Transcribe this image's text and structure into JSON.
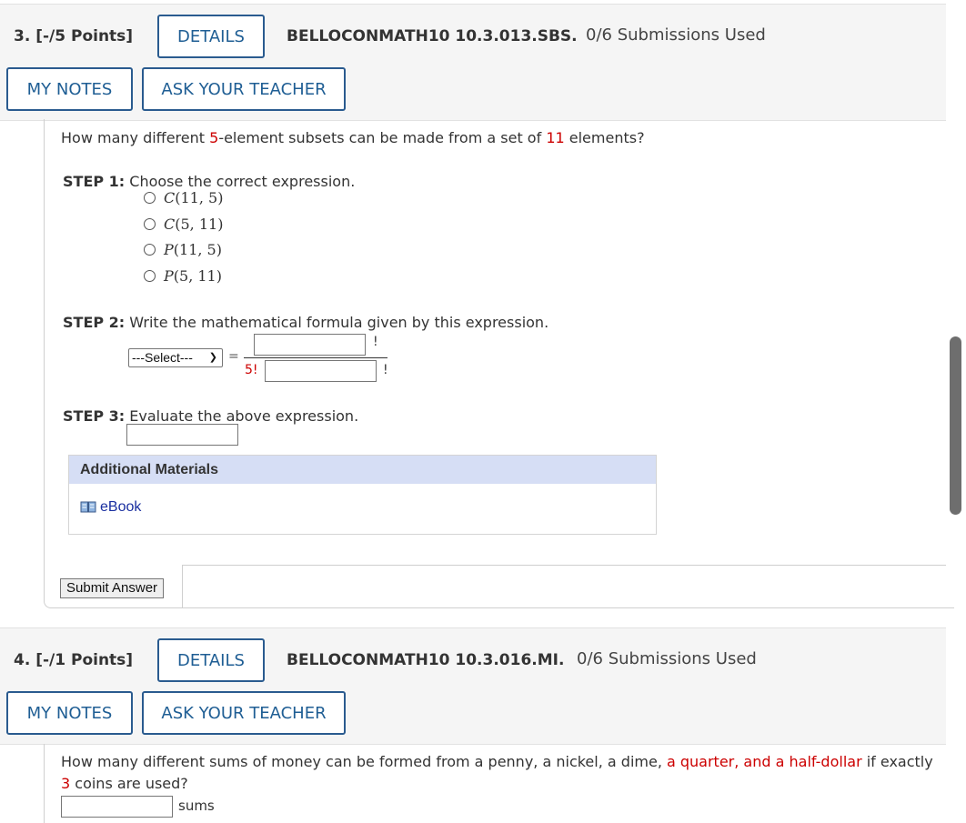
{
  "q3": {
    "number": "3.  [-/5 Points]",
    "details_label": "DETAILS",
    "code": "BELLOCONMATH10 10.3.013.SBS.",
    "submissions": "0/6 Submissions Used",
    "my_notes_label": "MY NOTES",
    "ask_teacher_label": "ASK YOUR TEACHER",
    "question": {
      "pre": "How many different ",
      "n1": "5",
      "mid": "-element subsets can be made from a set of ",
      "n2": "11",
      "post": " elements?"
    },
    "step1": {
      "label": "STEP 1:",
      "text": " Choose the correct expression.",
      "options": [
        {
          "fn": "C",
          "args": "(11, 5)"
        },
        {
          "fn": "C",
          "args": "(5, 11)"
        },
        {
          "fn": "P",
          "args": "(11, 5)"
        },
        {
          "fn": "P",
          "args": "(5, 11)"
        }
      ]
    },
    "step2": {
      "label": "STEP 2:",
      "text": " Write the mathematical formula given by this expression.",
      "select_value": "---Select---",
      "equals": "=",
      "factorial": "!",
      "denom_prefix": "5!",
      "numerator_value": "",
      "denominator_value": ""
    },
    "step3": {
      "label": "STEP 3:",
      "text": " Evaluate the above expression.",
      "answer_value": ""
    },
    "additional_materials_title": "Additional Materials",
    "ebook_label": "eBook",
    "submit_label": "Submit Answer"
  },
  "q4": {
    "number": "4.  [-/1 Points]",
    "details_label": "DETAILS",
    "code": "BELLOCONMATH10 10.3.016.MI.",
    "submissions": "0/6 Submissions Used",
    "my_notes_label": "MY NOTES",
    "ask_teacher_label": "ASK YOUR TEACHER",
    "question": {
      "pre": "How many different sums of money can be formed from a penny, a nickel, a dime, ",
      "red1": "a quarter, and a half-dollar",
      "mid": " if exactly",
      "red2": "3",
      "post": " coins are used?"
    },
    "answer_value": "",
    "unit": "sums"
  },
  "colors": {
    "accent": "#1f5e94",
    "highlight_red": "#cc0000",
    "additional_materials_header": "#d6def5",
    "header_bg": "#f5f5f5"
  }
}
